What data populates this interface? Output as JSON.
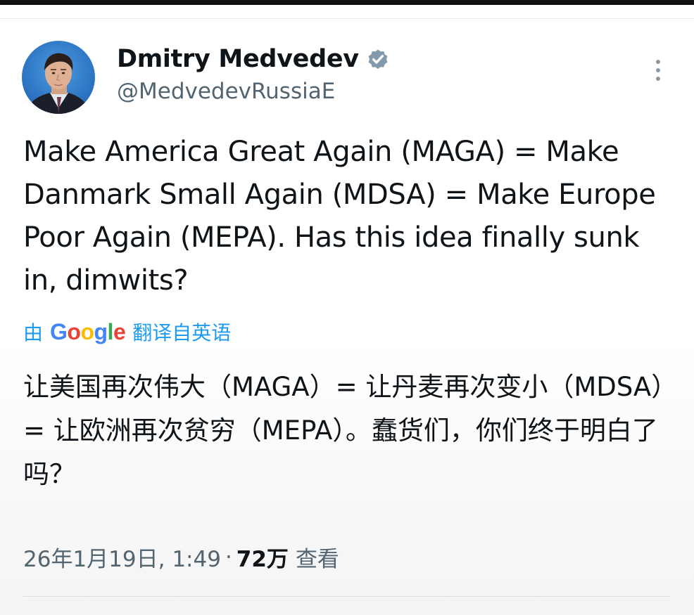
{
  "author": {
    "name": "Dmitry Medvedev",
    "handle": "@MedvedevRussiaE",
    "verified": true
  },
  "post": {
    "text": "Make America Great Again (MAGA) = Make Danmark Small Again (MDSA) = Make Europe Poor Again (MEPA). Has this idea finally sunk in, dimwits?",
    "translation_prefix": "由",
    "translation_provider": "Google",
    "translation_suffix": "翻译自英语",
    "translated_text": "让美国再次伟大（MAGA）= 让丹麦再次变小（MDSA）= 让欧洲再次贫穷（MEPA）。蠢货们，你们终于明白了吗？"
  },
  "meta": {
    "datetime": "26年1月19日, 1:49",
    "separator": "·",
    "views_count": "72万",
    "views_label": "查看"
  },
  "colors": {
    "link": "#1d9bf0",
    "secondary_text": "#536471",
    "verified_badge": "#829aab",
    "avatar_background": "#2f7fd0"
  },
  "icons": {
    "verified": "verified-badge-icon",
    "more": "more-vertical-icon",
    "avatar": "avatar-photo"
  }
}
